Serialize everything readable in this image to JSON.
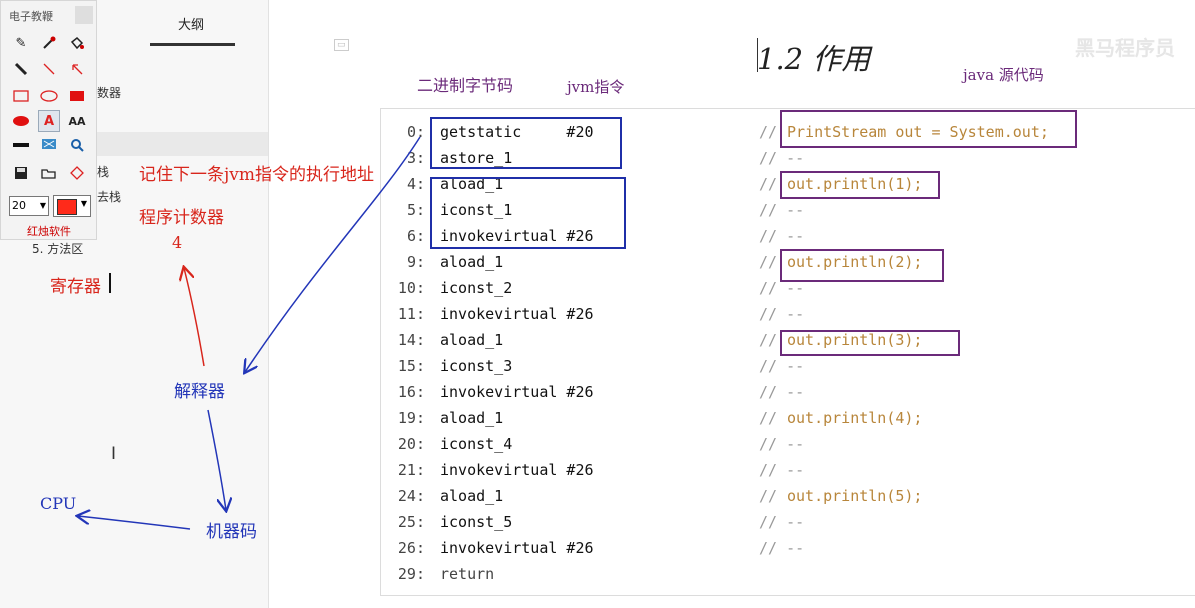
{
  "outline": {
    "title": "大纲",
    "fragments": [
      "数器",
      "栈",
      "去栈",
      "5. 方法区"
    ]
  },
  "toolbar": {
    "title": "电子教鞭",
    "brush_size": "20",
    "pen_color": "#ff2a1a",
    "brand": "红烛软件",
    "tools": [
      "eraser-icon",
      "pipette-icon",
      "bucket-icon",
      "marker-icon",
      "line-icon",
      "arrow-icon",
      "rectangle-icon",
      "ellipse-icon",
      "filled-rectangle-icon",
      "filled-ellipse-icon",
      "text-icon",
      "font-size-icon",
      "thick-line-icon",
      "screen-icon",
      "magnifier-icon",
      "save-icon",
      "open-icon",
      "diamond-icon"
    ]
  },
  "slide": {
    "title": "1.2 作用",
    "watermark": "黑马程序员",
    "label_bytecode": "二进制字节码",
    "label_jvm": "jvm指令",
    "label_java": "java 源代码"
  },
  "annotations": {
    "remember_next": "记住下一条jvm指令的执行地址",
    "program_counter": "程序计数器",
    "pc_value": "4",
    "register": "寄存器",
    "interpreter": "解释器",
    "machine_code": "机器码",
    "cpu": "CPU"
  },
  "code": [
    {
      "off": "0:",
      "instr": "getstatic     #20",
      "cmt": "//",
      "src": "PrintStream out = System.out;"
    },
    {
      "off": "3:",
      "instr": "astore_1",
      "cmt": "// --",
      "src": ""
    },
    {
      "off": "4:",
      "instr": "aload_1",
      "cmt": "//",
      "src": "out.println(1);"
    },
    {
      "off": "5:",
      "instr": "iconst_1",
      "cmt": "// --",
      "src": ""
    },
    {
      "off": "6:",
      "instr": "invokevirtual #26",
      "cmt": "// --",
      "src": ""
    },
    {
      "off": "9:",
      "instr": "aload_1",
      "cmt": "//",
      "src": "out.println(2);"
    },
    {
      "off": "10:",
      "instr": "iconst_2",
      "cmt": "// --",
      "src": ""
    },
    {
      "off": "11:",
      "instr": "invokevirtual #26",
      "cmt": "// --",
      "src": ""
    },
    {
      "off": "14:",
      "instr": "aload_1",
      "cmt": "//",
      "src": "out.println(3);"
    },
    {
      "off": "15:",
      "instr": "iconst_3",
      "cmt": "// --",
      "src": ""
    },
    {
      "off": "16:",
      "instr": "invokevirtual #26",
      "cmt": "// --",
      "src": ""
    },
    {
      "off": "19:",
      "instr": "aload_1",
      "cmt": "//",
      "src": "out.println(4);"
    },
    {
      "off": "20:",
      "instr": "iconst_4",
      "cmt": "// --",
      "src": ""
    },
    {
      "off": "21:",
      "instr": "invokevirtual #26",
      "cmt": "// --",
      "src": ""
    },
    {
      "off": "24:",
      "instr": "aload_1",
      "cmt": "//",
      "src": "out.println(5);"
    },
    {
      "off": "25:",
      "instr": "iconst_5",
      "cmt": "// --",
      "src": ""
    },
    {
      "off": "26:",
      "instr": "invokevirtual #26",
      "cmt": "// --",
      "src": ""
    },
    {
      "off": "29:",
      "instr": "return",
      "cmt": "",
      "src": ""
    }
  ],
  "colors": {
    "annotation_red": "#d8261c",
    "annotation_blue": "#2336b8",
    "label_purple": "#6b2a7a",
    "box_blue": "#1f2fa8",
    "box_purple": "#6b2a7a",
    "source_comment": "#b8863b"
  }
}
